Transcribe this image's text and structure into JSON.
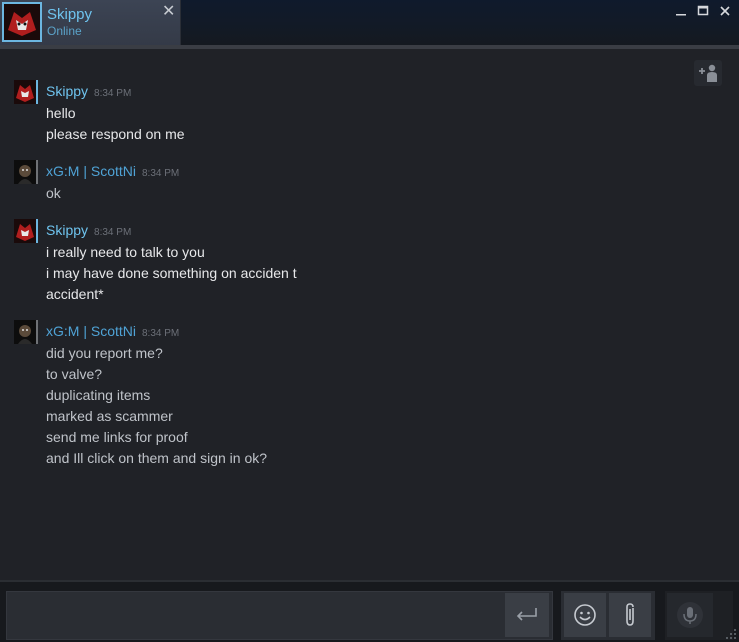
{
  "tab": {
    "name": "Skippy",
    "status": "Online",
    "close": "✕"
  },
  "window_controls": {
    "minimize": "—",
    "maximize": "☐",
    "close": "✕"
  },
  "colors": {
    "accent": "#6fc4ef",
    "background": "#202227",
    "titlebar": "#121a27",
    "text": "#e7e8ea"
  },
  "messages": [
    {
      "sender": "Skippy",
      "time": "8:34 PM",
      "lines": [
        "hello",
        "please respond on me"
      ]
    },
    {
      "sender": "xG:M | ScottNi",
      "time": "8:34 PM",
      "lines": [
        "ok"
      ]
    },
    {
      "sender": "Skippy",
      "time": "8:34 PM",
      "lines": [
        "i really need to talk to you",
        "i may have done something on acciden t",
        "accident*"
      ]
    },
    {
      "sender": "xG:M | ScottNi",
      "time": "8:34 PM",
      "lines": [
        "did you report me?",
        "to valve?",
        "duplicating items",
        "marked as scammer",
        "send me links for proof",
        "and Ill click on them and sign in ok?"
      ]
    }
  ],
  "input": {
    "value": "",
    "placeholder": ""
  },
  "icons": {
    "add_friend": "add-friend-icon",
    "send": "enter-icon",
    "emoticon": "smiley-icon",
    "attach": "paperclip-icon",
    "voice": "microphone-icon"
  }
}
